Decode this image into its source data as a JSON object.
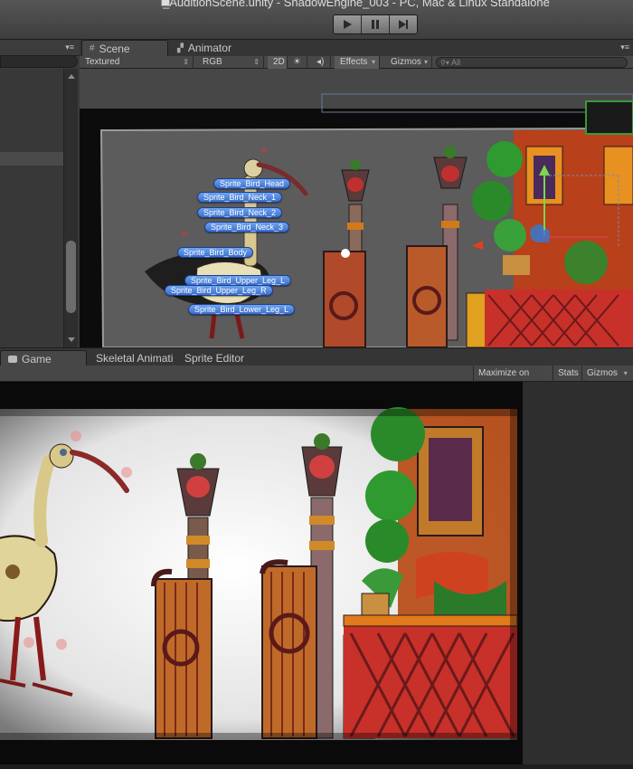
{
  "window": {
    "title": "_AuditionScene.unity - ShadowEngine_003 - PC, Mac & Linux Standalone"
  },
  "playbar": {
    "play_icon": "play-icon",
    "pause_icon": "pause-icon",
    "step_icon": "step-icon"
  },
  "scene_tabs": {
    "scene": "Scene",
    "animator": "Animator"
  },
  "scene_toolbar": {
    "render_mode": "Textured",
    "color_mode": "RGB",
    "mode_2d": "2D",
    "effects": "Effects",
    "gizmos": "Gizmos",
    "search_placeholder": "All"
  },
  "bones": [
    "Sprite_Bird_Head",
    "Sprite_Bird_Neck_1",
    "Sprite_Bird_Neck_2",
    "Sprite_Bird_Neck_3",
    "Sprite_Bird_Body",
    "Sprite_Bird_Upper_Leg_L",
    "Sprite_Bird_Upper_Leg_R",
    "Sprite_Bird_Lower_Leg_L"
  ],
  "lower_tabs": {
    "game": "Game",
    "skeletal": "Skeletal Animation",
    "sprite_editor": "Sprite Editor"
  },
  "game_toolbar": {
    "maximize": "Maximize on Play",
    "stats": "Stats",
    "gizmos": "Gizmos"
  },
  "colors": {
    "accent_blue": "#3a6fcc",
    "panel_dark": "#3a3a3a",
    "scene_bg": "#474747",
    "puppet_red": "#c0392b",
    "puppet_green": "#2f9a2f",
    "puppet_orange": "#e07b1a"
  }
}
